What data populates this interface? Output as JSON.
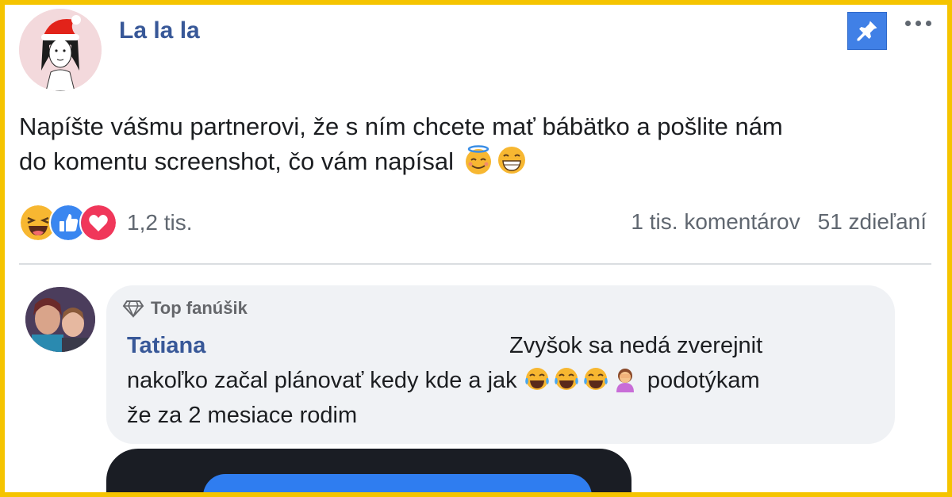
{
  "post": {
    "author": "La la la",
    "text_line1": "Napíšte vášmu partnerovi, že s ním chcete mať bábätko a pošlite nám",
    "text_line2": "do komentu screenshot, čo vám napísal",
    "reaction_count": "1,2 tis.",
    "comments_count": "1 tis. komentárov",
    "shares_count": "51 zdieľaní"
  },
  "comment": {
    "badge": "Top fanúšik",
    "author": "Tatiana",
    "line1": "Zvyšok sa nedá zverejnit",
    "line2_start": "nakoľko začal plánovať kedy kde a jak",
    "line2_end": "podotýkam",
    "line3": "že za 2 mesiace rodim"
  },
  "icons": {
    "pin": "pin-icon",
    "more": "more-icon",
    "badge": "diamond-icon",
    "reactions": [
      "haha-icon",
      "like-icon",
      "love-icon"
    ]
  },
  "colors": {
    "frame": "#f5c400",
    "author": "#385898",
    "pin_button": "#4080e6",
    "bubble": "#f0f2f5"
  }
}
